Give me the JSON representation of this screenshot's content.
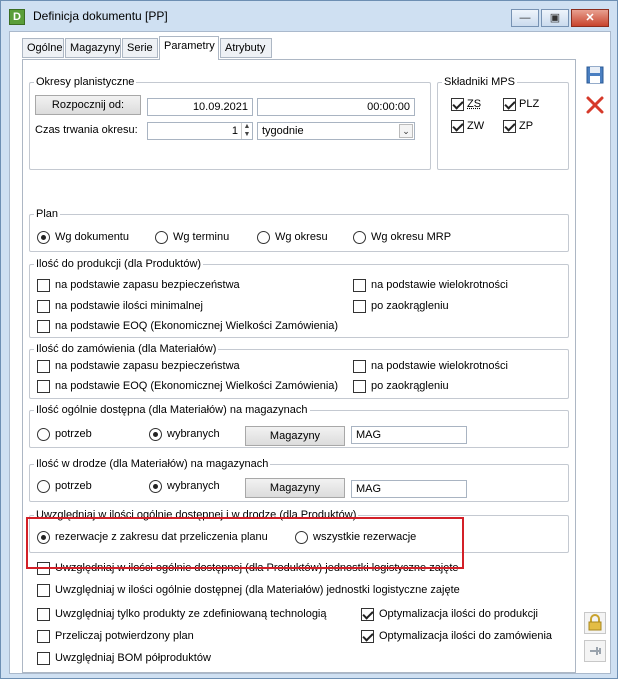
{
  "window": {
    "title": "Definicja dokumentu [PP]",
    "minimize": "—",
    "maximize": "▣",
    "close": "✕"
  },
  "tabs": [
    "Ogólne",
    "Magazyny",
    "Serie",
    "Parametry",
    "Atrybuty"
  ],
  "active_tab": "Parametry",
  "okresy": {
    "legend": "Okresy planistyczne",
    "start_button": "Rozpocznij od:",
    "date": "10.09.2021",
    "time": "00:00:00",
    "duration_label": "Czas trwania okresu:",
    "duration_value": "1",
    "unit": "tygodnie"
  },
  "mps": {
    "legend": "Składniki MPS",
    "items": [
      {
        "label": "ZS",
        "checked": true
      },
      {
        "label": "PLZ",
        "checked": true
      },
      {
        "label": "ZW",
        "checked": true
      },
      {
        "label": "ZP",
        "checked": true
      }
    ]
  },
  "plan": {
    "legend": "Plan",
    "options": [
      "Wg dokumentu",
      "Wg terminu",
      "Wg okresu",
      "Wg okresu MRP"
    ],
    "selected": 0
  },
  "produkcja": {
    "legend": "Ilość do produkcji (dla Produktów)",
    "items": [
      "na podstawie zapasu bezpieczeństwa",
      "na podstawie ilości minimalnej",
      "na podstawie EOQ (Ekonomicznej Wielkości Zamówienia)",
      "na podstawie wielokrotności",
      "po zaokrągleniu"
    ]
  },
  "zamowienia": {
    "legend": "Ilość do zamówienia (dla Materiałów)",
    "items": [
      "na podstawie zapasu bezpieczeństwa",
      "na podstawie EOQ (Ekonomicznej Wielkości Zamówienia)",
      "na podstawie wielokrotności",
      "po zaokrągleniu"
    ]
  },
  "dostepna": {
    "legend": "Ilość ogólnie dostępna (dla Materiałów) na magazynach",
    "options": [
      "potrzeb",
      "wybranych"
    ],
    "selected": 1,
    "button": "Magazyny",
    "value": "MAG"
  },
  "wdrodze": {
    "legend": "Ilość w drodze (dla Materiałów) na magazynach",
    "options": [
      "potrzeb",
      "wybranych"
    ],
    "selected": 1,
    "button": "Magazyny",
    "value": "MAG"
  },
  "uwzgl": {
    "legend": "Uwzględniaj w ilości ogólnie dostępnej i w drodze (dla Produktów)",
    "options": [
      "rezerwacje z zakresu dat przeliczenia planu",
      "wszystkie rezerwacje"
    ],
    "selected": 0
  },
  "logistyczne": [
    {
      "label": "Uwzględniaj w ilości ogólnie dostępnej (dla Produktów) jednostki logistyczne zajęte",
      "checked": false
    },
    {
      "label": "Uwzględniaj w ilości ogólnie dostępnej (dla Materiałów) jednostki logistyczne zajęte",
      "checked": false
    }
  ],
  "bottom_left": [
    {
      "label": "Uwzględniaj tylko produkty ze zdefiniowaną technologią",
      "checked": false
    },
    {
      "label": "Przeliczaj potwierdzony plan",
      "checked": false
    },
    {
      "label": "Uwzględniaj BOM półproduktów",
      "checked": false
    }
  ],
  "bottom_right": [
    {
      "label": "Optymalizacja ilości do produkcji",
      "checked": true
    },
    {
      "label": "Optymalizacja ilości do zamówienia",
      "checked": true
    }
  ],
  "colors": {
    "highlight": "#d32028",
    "accent": "#4a7fc1"
  }
}
